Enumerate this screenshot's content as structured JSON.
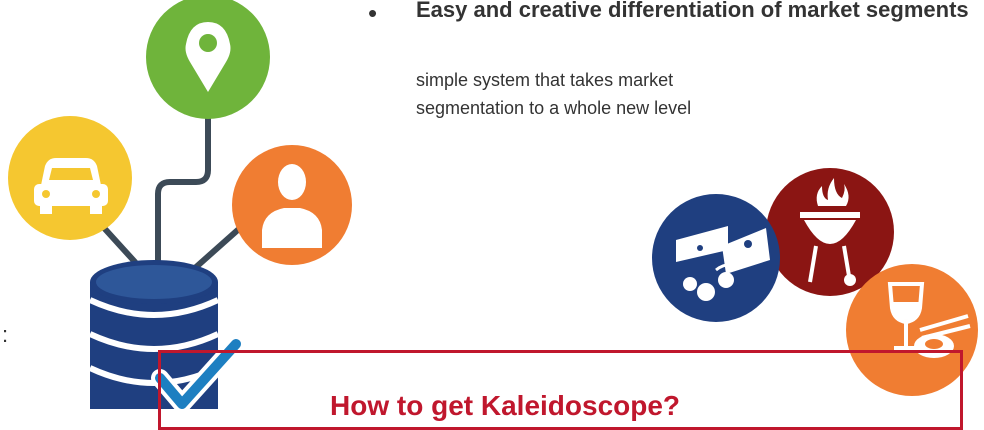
{
  "bullet": {
    "marker": "•",
    "title": "Easy and creative differentiation of market segments",
    "description": "simple system that takes market segmentation to a whole new level"
  },
  "stray_text": ":",
  "cta": {
    "text": "How to get Kaleidoscope?"
  },
  "colors": {
    "yellow": "#f5c730",
    "green": "#6fb43b",
    "orange": "#f07d32",
    "navy": "#1f3f80",
    "dark_red": "#8b1513",
    "brand_red": "#c0172d",
    "connector": "#3c4a57"
  },
  "icons": [
    "car-icon",
    "location-pin-icon",
    "person-icon",
    "database-icon",
    "checkmark-icon",
    "cheese-olives-icon",
    "grill-icon",
    "wine-sushi-icon"
  ]
}
